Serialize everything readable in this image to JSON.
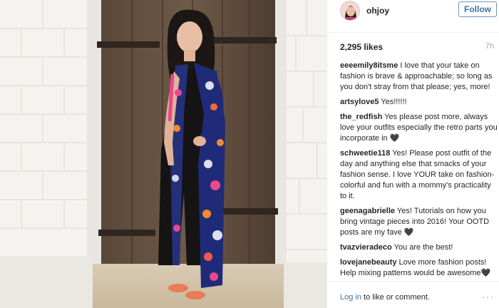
{
  "post": {
    "username": "ohjoy",
    "follow_label": "Follow",
    "likes": "2,295 likes",
    "time": "7h"
  },
  "comments": [
    {
      "user": "eeeemily8itsme",
      "text": "I love that your take on fashion is brave & approachable; so long as you don't stray from that please; yes, more!"
    },
    {
      "user": "artsylove5",
      "text": "Yes!!!!!!"
    },
    {
      "user": "the_redfish",
      "text": "Yes please post more, always love your outfits especially the retro parts you incorporate in 🖤"
    },
    {
      "user": "schweetie118",
      "text": "Yes! Please post outfit of the day and anything else that smacks of your fashion sense. I love YOUR take on fashion-colorful and fun with a mommy's practicality to it."
    },
    {
      "user": "geenagabrielle",
      "text": "Yes! Tutorials on how you bring vintage pieces into 2016! Your OOTD posts are my fave 🖤"
    },
    {
      "user": "tvazvieradeco",
      "text": "You are the best!"
    },
    {
      "user": "lovejanebeauty",
      "text": "Love more fashion posts! Help mixing patterns would be awesome🖤"
    }
  ],
  "footer": {
    "login_link": "Log in",
    "login_rest": " to like or comment.",
    "more_glyph": "···"
  },
  "colors": {
    "link_blue": "#3f729b",
    "text": "#262626",
    "muted": "#a5a7aa"
  },
  "icons": {
    "more": "more-options-icon"
  }
}
